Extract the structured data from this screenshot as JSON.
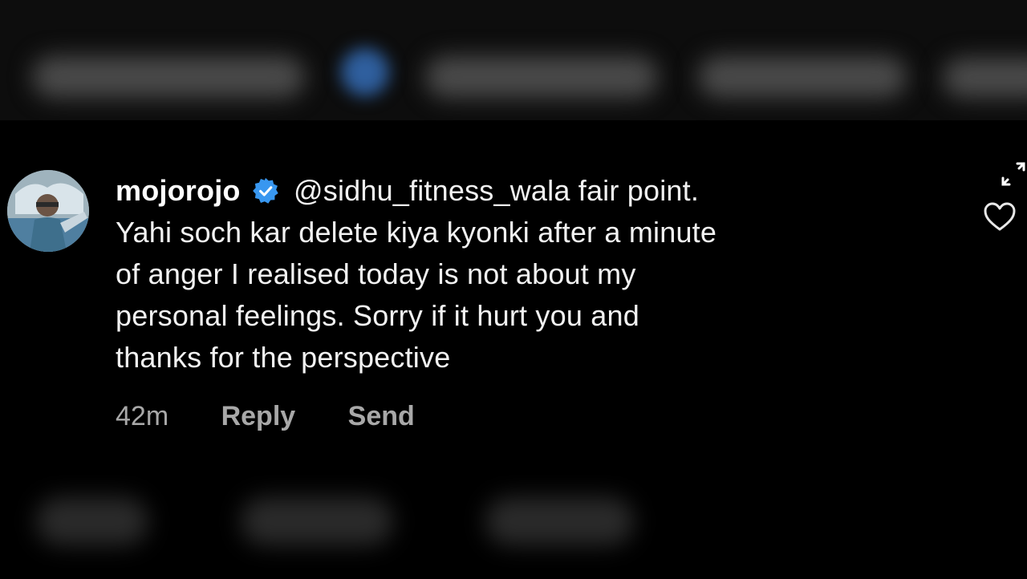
{
  "comment": {
    "username": "mojorojo",
    "mention": "@sidhu_fitness_wala",
    "text_lines": [
      "fair point.",
      "Yahi soch kar delete kiya kyonki after a minute",
      "of anger I realised today is not about my",
      "personal feelings. Sorry if it hurt you and",
      "thanks for the perspective"
    ],
    "timestamp": "42m",
    "reply_label": "Reply",
    "send_label": "Send"
  },
  "icons": {
    "verified": "verified-badge-icon",
    "expand": "expand-icon",
    "like": "heart-icon"
  },
  "colors": {
    "background": "#000000",
    "text": "#f2f2f2",
    "meta_text": "#a8a8a8",
    "verified_blue": "#3897f0"
  }
}
